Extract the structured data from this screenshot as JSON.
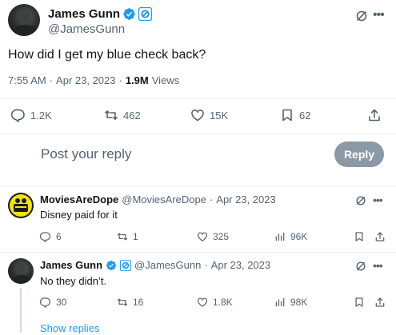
{
  "main_tweet": {
    "author_name": "James Gunn",
    "author_handle": "@JamesGunn",
    "text": "How did I get my blue check back?",
    "time": "7:55 AM",
    "date": "Apr 23, 2023",
    "views_count": "1.9M",
    "views_label": "Views",
    "stats": {
      "replies": "1.2K",
      "retweets": "462",
      "likes": "15K",
      "bookmarks": "62"
    }
  },
  "composer": {
    "placeholder": "Post your reply",
    "reply_button": "Reply"
  },
  "replies": [
    {
      "author_name": "MoviesAreDope",
      "author_handle": "@MoviesAreDope",
      "date": "Apr 23, 2023",
      "text": "Disney paid for it",
      "stats": {
        "replies": "6",
        "retweets": "1",
        "likes": "325",
        "views": "96K"
      }
    },
    {
      "author_name": "James Gunn",
      "author_handle": "@JamesGunn",
      "date": "Apr 23, 2023",
      "text": "No they didn’t.",
      "stats": {
        "replies": "30",
        "retweets": "16",
        "likes": "1.8K",
        "views": "98K"
      }
    }
  ],
  "show_replies_label": "Show replies",
  "colors": {
    "accent": "#1d9bf0",
    "text_primary": "#0f1419",
    "text_secondary": "#536471",
    "reply_button_bg": "#8b98a5"
  }
}
